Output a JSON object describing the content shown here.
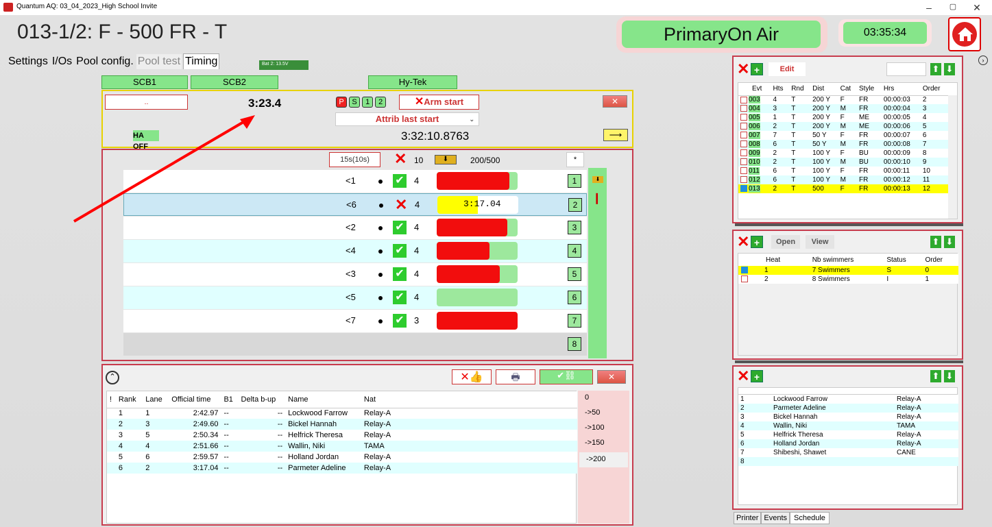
{
  "window": {
    "title": "Quantum AQ: 03_04_2023_High School Invite",
    "min": "–",
    "max": "▢",
    "close": "✕"
  },
  "header": {
    "title": "013-1/2: F - 500 FR - T",
    "on_air": "PrimaryOn Air",
    "clock": "03:35:34"
  },
  "tabs": [
    {
      "label": "Settings"
    },
    {
      "label": "I/Os"
    },
    {
      "label": "Pool config."
    },
    {
      "label": "Pool test"
    },
    {
      "label": "Timing"
    }
  ],
  "battery": "Bat 2: 13.5V",
  "outputs": {
    "scb1": "SCB1",
    "scb2": "SCB2",
    "hytek": "Hy-Tek"
  },
  "start": {
    "field": "..",
    "time": "3:23.4",
    "codes": [
      "P",
      "S",
      "1",
      "2"
    ],
    "arm": "Arm start",
    "attrib": "Attrib last start",
    "ha": "HA OFF",
    "clock": "3:32:10.8763"
  },
  "heat": {
    "interval": "15s(10s)",
    "count": "10",
    "dist": "200/500",
    "star": "*"
  },
  "lanes": [
    {
      "order": "<1",
      "num": "1",
      "laps": "4",
      "status": "ok",
      "progress": 0.9,
      "time": ""
    },
    {
      "order": "<6",
      "num": "2",
      "laps": "4",
      "status": "x",
      "progress": 0.5,
      "time": "3:17.04"
    },
    {
      "order": "<2",
      "num": "3",
      "laps": "4",
      "status": "ok",
      "progress": 0.87,
      "time": ""
    },
    {
      "order": "<4",
      "num": "4",
      "laps": "4",
      "status": "ok",
      "progress": 0.65,
      "time": ""
    },
    {
      "order": "<3",
      "num": "5",
      "laps": "4",
      "status": "ok",
      "progress": 0.78,
      "time": ""
    },
    {
      "order": "<5",
      "num": "6",
      "laps": "4",
      "status": "ok",
      "progress": 0,
      "time": ""
    },
    {
      "order": "<7",
      "num": "7",
      "laps": "3",
      "status": "ok",
      "progress": 1,
      "time": ""
    },
    {
      "order": "",
      "num": "8",
      "laps": "",
      "status": "",
      "progress": null,
      "time": ""
    }
  ],
  "results": {
    "headers": [
      "!",
      "Rank",
      "Lane",
      "Official time",
      "B1",
      "Delta b-up",
      "Name",
      "Nat"
    ],
    "rows": [
      [
        "",
        "1",
        "1",
        "2:42.97",
        "--",
        "--",
        "Lockwood Farrow",
        "Relay-A"
      ],
      [
        "",
        "2",
        "3",
        "2:49.60",
        "--",
        "--",
        "Bickel Hannah",
        "Relay-A"
      ],
      [
        "",
        "3",
        "5",
        "2:50.34",
        "--",
        "--",
        "Helfrick Theresa",
        "Relay-A"
      ],
      [
        "",
        "4",
        "4",
        "2:51.66",
        "--",
        "--",
        "Wallin, Niki",
        "TAMA"
      ],
      [
        "",
        "5",
        "6",
        "2:59.57",
        "--",
        "--",
        "Holland Jordan",
        "Relay-A"
      ],
      [
        "",
        "6",
        "2",
        "3:17.04",
        "--",
        "--",
        "Parmeter Adeline",
        "Relay-A"
      ]
    ],
    "splits": [
      "0",
      "->50",
      "->100",
      "->150",
      "->200"
    ]
  },
  "events": {
    "edit": "Edit",
    "headers": [
      "Evt",
      "Hts",
      "Rnd",
      "Dist",
      "Cat",
      "Style",
      "Hrs",
      "Order"
    ],
    "rows": [
      [
        "003",
        "4",
        "T",
        "200 Y",
        "F",
        "FR",
        "00:00:03",
        "2"
      ],
      [
        "004",
        "3",
        "T",
        "200 Y",
        "M",
        "FR",
        "00:00:04",
        "3"
      ],
      [
        "005",
        "1",
        "T",
        "200 Y",
        "F",
        "ME",
        "00:00:05",
        "4"
      ],
      [
        "006",
        "2",
        "T",
        "200 Y",
        "M",
        "ME",
        "00:00:06",
        "5"
      ],
      [
        "007",
        "7",
        "T",
        "50 Y",
        "F",
        "FR",
        "00:00:07",
        "6"
      ],
      [
        "008",
        "6",
        "T",
        "50 Y",
        "M",
        "FR",
        "00:00:08",
        "7"
      ],
      [
        "009",
        "2",
        "T",
        "100 Y",
        "F",
        "BU",
        "00:00:09",
        "8"
      ],
      [
        "010",
        "2",
        "T",
        "100 Y",
        "M",
        "BU",
        "00:00:10",
        "9"
      ],
      [
        "011",
        "6",
        "T",
        "100 Y",
        "F",
        "FR",
        "00:00:11",
        "10"
      ],
      [
        "012",
        "6",
        "T",
        "100 Y",
        "M",
        "FR",
        "00:00:12",
        "11"
      ],
      [
        "013",
        "2",
        "T",
        "500",
        "F",
        "FR",
        "00:00:13",
        "12"
      ]
    ]
  },
  "heats": {
    "open": "Open",
    "view": "View",
    "headers": [
      "Heat",
      "Nb swimmers",
      "Status",
      "Order"
    ],
    "rows": [
      [
        "1",
        "7 Swimmers",
        "S",
        "0"
      ],
      [
        "2",
        "8 Swimmers",
        "I",
        "1"
      ]
    ]
  },
  "entries": {
    "rows": [
      [
        "1",
        "Lockwood Farrow",
        "Relay-A"
      ],
      [
        "2",
        "Parmeter Adeline",
        "Relay-A"
      ],
      [
        "3",
        "Bickel Hannah",
        "Relay-A"
      ],
      [
        "4",
        "Wallin, Niki",
        "TAMA"
      ],
      [
        "5",
        "Helfrick Theresa",
        "Relay-A"
      ],
      [
        "6",
        "Holland Jordan",
        "Relay-A"
      ],
      [
        "7",
        "Shibeshi, Shawet",
        "CANE"
      ],
      [
        "8",
        "",
        ""
      ]
    ]
  },
  "bottom_tabs": [
    "Printer",
    "Events",
    "Schedule"
  ],
  "colors": {
    "panel_border": "#c73b4d",
    "green": "#86e58a",
    "red": "#f20d0d",
    "yellow_border": "#e8d200"
  }
}
